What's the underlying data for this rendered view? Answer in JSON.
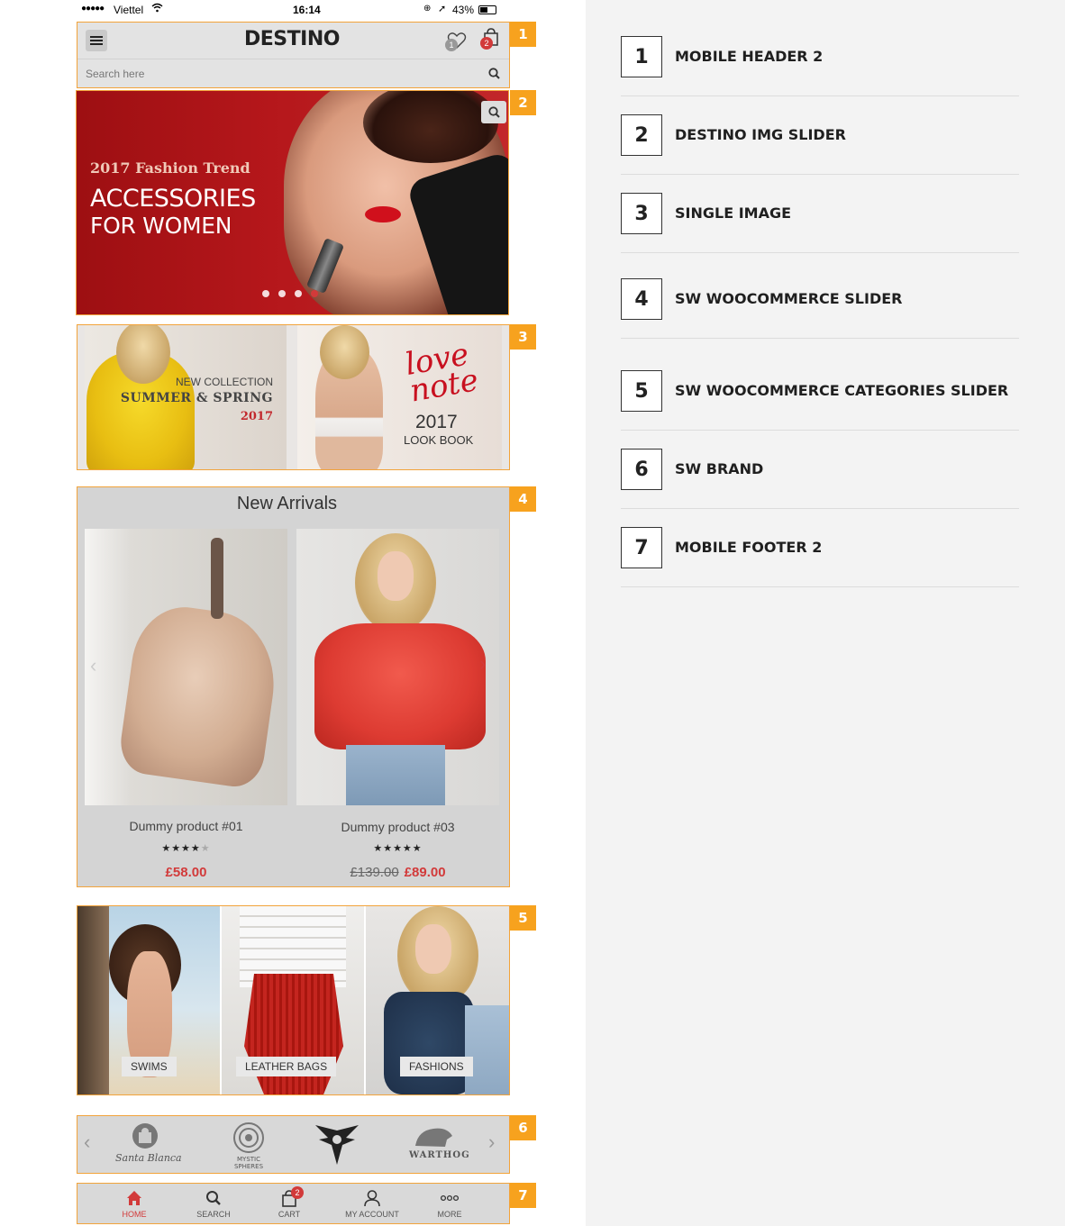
{
  "status_bar": {
    "carrier": "Viettel",
    "time": "16:14",
    "battery": "43%"
  },
  "header": {
    "logo": "DESTINO",
    "wishlist_count": "1",
    "cart_count": "2",
    "search_placeholder": "Search here"
  },
  "slider": {
    "subtitle": "2017 Fashion Trend",
    "title_line1": "ACCESSORIES",
    "title_line2": "FOR  WOMEN",
    "dots": 4,
    "active_dot": 4
  },
  "single_image": {
    "left": {
      "line1": "NEW COLLECTION",
      "line2": "SUMMER & SPRING",
      "line3": "2017"
    },
    "right": {
      "script": "love note",
      "year": "2017",
      "caption": "LOOK BOOK"
    }
  },
  "new_arrivals": {
    "title": "New Arrivals",
    "products": [
      {
        "name": "Dummy product #01",
        "rating": 4,
        "stars": "★★★★",
        "star_empty": "★",
        "price": "£58.00",
        "old_price": ""
      },
      {
        "name": "Dummy product #03",
        "rating": 5,
        "stars": "★★★★★",
        "star_empty": "",
        "price": "£89.00",
        "old_price": "£139.00"
      }
    ]
  },
  "categories": [
    {
      "label": "SWIMS"
    },
    {
      "label": "LEATHER BAGS"
    },
    {
      "label": "FASHIONS"
    }
  ],
  "brands": [
    {
      "name": "Santa Blanca"
    },
    {
      "name": "MYSTIC SPHERES"
    },
    {
      "name": "eagle"
    },
    {
      "name": "WARTHOG"
    }
  ],
  "footer_nav": [
    {
      "label": "HOME",
      "icon": "home-icon"
    },
    {
      "label": "SEARCH",
      "icon": "search-icon"
    },
    {
      "label": "CART",
      "icon": "cart-icon",
      "badge": "2"
    },
    {
      "label": "MY ACCOUNT",
      "icon": "user-icon"
    },
    {
      "label": "MORE",
      "icon": "more-icon"
    }
  ],
  "tags": [
    "1",
    "2",
    "3",
    "4",
    "5",
    "6",
    "7"
  ],
  "legend": [
    {
      "num": "1",
      "label": "MOBILE HEADER 2"
    },
    {
      "num": "2",
      "label": "DESTINO IMG SLIDER"
    },
    {
      "num": "3",
      "label": "SINGLE IMAGE"
    },
    {
      "num": "4",
      "label": "SW WOOCOMMERCE SLIDER"
    },
    {
      "num": "5",
      "label": "SW WOOCOMMERCE CATEGORIES SLIDER"
    },
    {
      "num": "6",
      "label": "SW BRAND"
    },
    {
      "num": "7",
      "label": "MOBILE FOOTER 2"
    }
  ],
  "colors": {
    "accent": "#f7a21e",
    "sale": "#d23a3a",
    "panel": "#f3f3f3"
  }
}
